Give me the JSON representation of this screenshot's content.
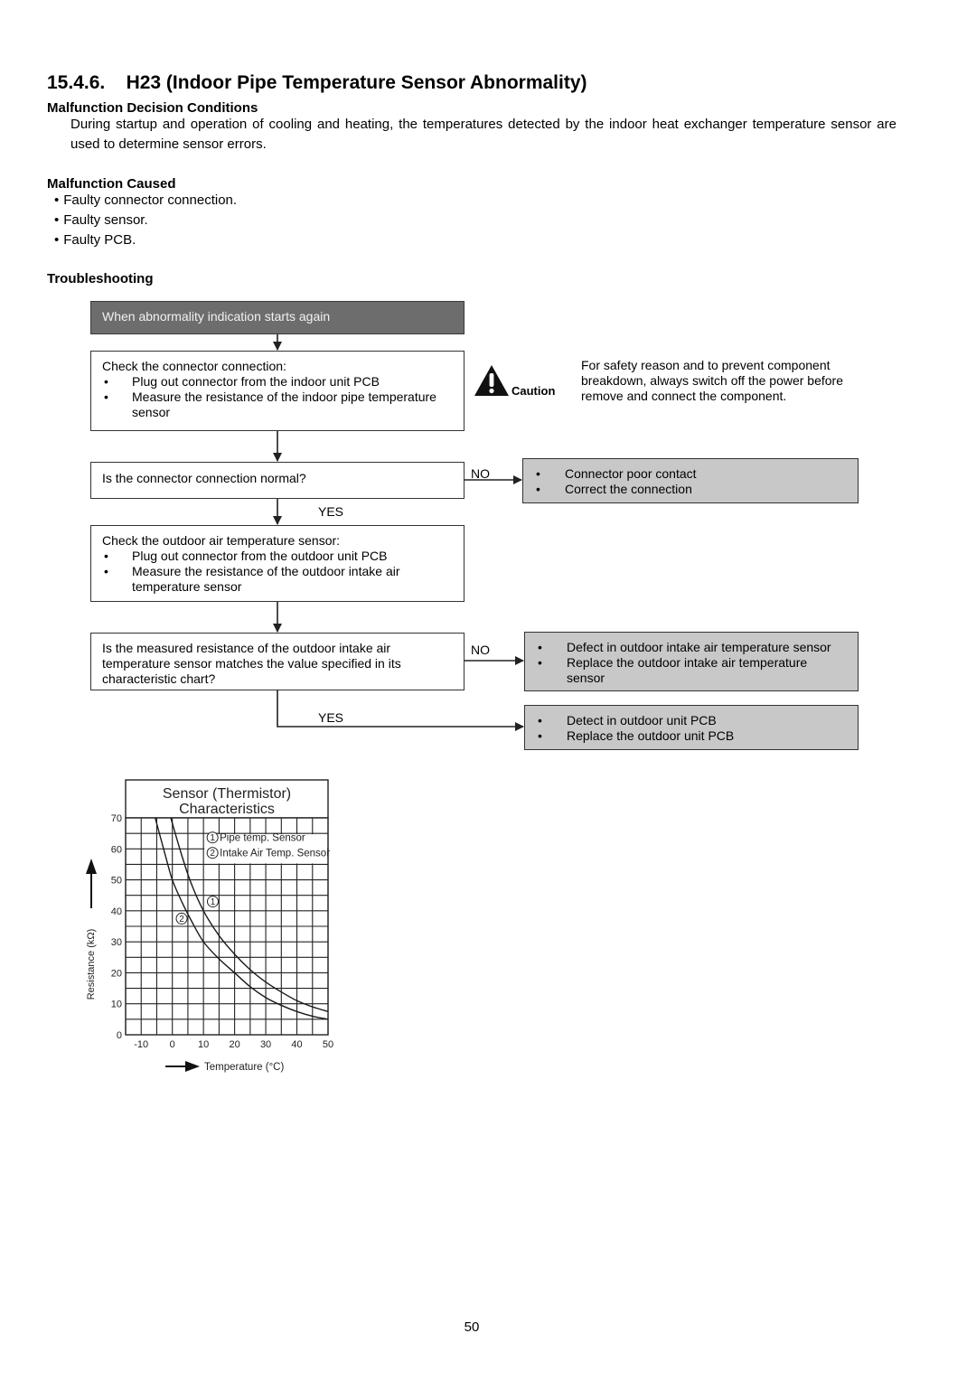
{
  "section": {
    "number": "15.4.6.",
    "title": "H23 (Indoor Pipe Temperature Sensor Abnormality)"
  },
  "decision_conditions": {
    "heading": "Malfunction Decision Conditions",
    "text": "During startup and operation of cooling and heating, the temperatures detected by the indoor heat exchanger temperature sensor are used to determine sensor errors."
  },
  "caused": {
    "heading": "Malfunction Caused",
    "items": [
      "Faulty connector connection.",
      "Faulty sensor.",
      "Faulty PCB."
    ]
  },
  "troubleshooting": {
    "heading": "Troubleshooting",
    "start": "When abnormality indication starts again",
    "step1": {
      "title": "Check the connector connection:",
      "items": [
        "Plug out connector from the indoor unit PCB",
        "Measure the resistance of the indoor pipe temperature sensor"
      ]
    },
    "caution": {
      "label": "Caution",
      "icon": "warning-triangle-icon",
      "text": "For safety reason and to prevent component breakdown, always switch off the power before remove and connect the component."
    },
    "question1": "Is the connector connection normal?",
    "no_label": "NO",
    "yes_label": "YES",
    "result1": [
      "Connector poor contact",
      "Correct the connection"
    ],
    "step2": {
      "title": "Check the outdoor air temperature sensor:",
      "items": [
        "Plug out connector from the outdoor unit PCB",
        "Measure the resistance of the outdoor intake air temperature sensor"
      ]
    },
    "question2": "Is the measured resistance of the outdoor intake air temperature sensor matches the value specified in its characteristic chart?",
    "result2": [
      "Defect in outdoor intake air temperature sensor",
      "Replace the outdoor intake air temperature sensor"
    ],
    "result3": [
      "Detect in outdoor unit PCB",
      "Replace the outdoor unit PCB"
    ]
  },
  "chart_data": {
    "type": "line",
    "title": "Sensor (Thermistor) Characteristics",
    "xlabel": "Temperature (°C)",
    "ylabel": "Resistance (kΩ)",
    "xlim": [
      -15,
      50
    ],
    "ylim": [
      0,
      70
    ],
    "xticks": [
      -10,
      0,
      10,
      20,
      30,
      40,
      50
    ],
    "yticks": [
      0,
      10,
      20,
      30,
      40,
      50,
      60,
      70
    ],
    "grid": true,
    "legend_position": "top-right",
    "series": [
      {
        "name": "Pipe temp. Sensor",
        "marker": "1",
        "x": [
          -0.5,
          3,
          6,
          10,
          15,
          20,
          25,
          30,
          35,
          40,
          45,
          50
        ],
        "y": [
          70,
          58,
          49,
          40,
          32,
          26,
          21,
          17,
          13.8,
          11,
          9,
          7.5
        ]
      },
      {
        "name": "Intake Air Temp. Sensor",
        "marker": "2",
        "x": [
          -5.5,
          -2,
          0,
          3,
          6,
          10,
          15,
          20,
          25,
          30,
          35,
          40,
          45,
          50
        ],
        "y": [
          70,
          57,
          50,
          43,
          37,
          30,
          24.5,
          20,
          15.5,
          12,
          9.5,
          7.5,
          6,
          5
        ]
      }
    ]
  },
  "page_number": "50"
}
